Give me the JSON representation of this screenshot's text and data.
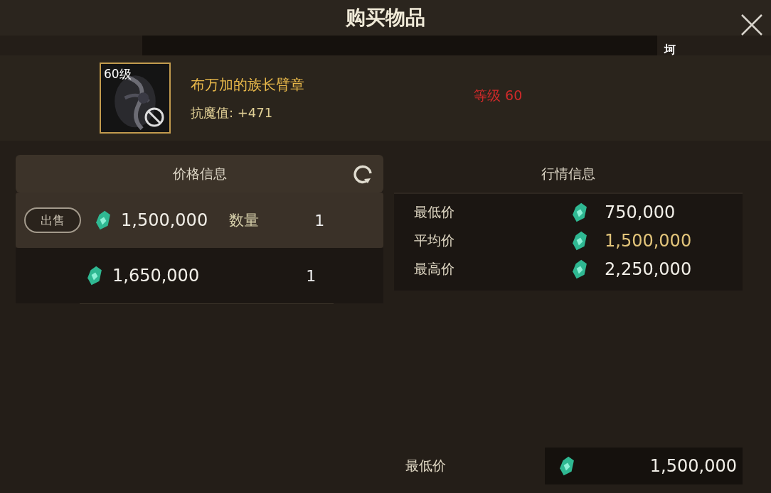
{
  "window": {
    "title": "购买物品"
  },
  "item": {
    "level_badge": "60级",
    "name": "布万加的族长臂章",
    "stat": "抗魔值:  +471",
    "requirement": "等级 60",
    "fragment": "坷",
    "usable": false
  },
  "price_panel": {
    "title": "价格信息",
    "listings": [
      {
        "selected": true,
        "action": "出售",
        "price": "1,500,000",
        "quantity_label": "数量",
        "quantity": "1"
      },
      {
        "selected": false,
        "price": "1,650,000",
        "quantity": "1"
      }
    ]
  },
  "market_panel": {
    "title": "行情信息",
    "stats": [
      {
        "label": "最低价",
        "value": "750,000",
        "highlighted": false
      },
      {
        "label": "平均价",
        "value": "1,500,000",
        "highlighted": true
      },
      {
        "label": "最高价",
        "value": "2,250,000",
        "highlighted": false
      }
    ]
  },
  "footer": {
    "label": "最低价",
    "value": "1,500,000"
  }
}
